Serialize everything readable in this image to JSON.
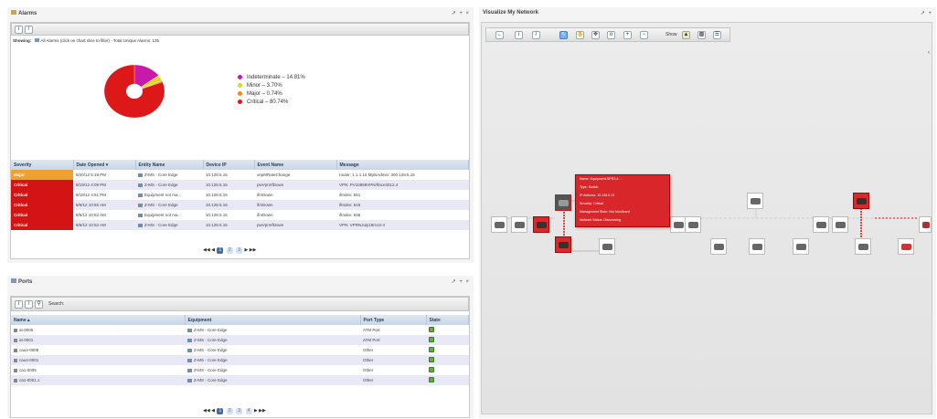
{
  "alarms": {
    "title": "Alarms",
    "controls": "↗ + ×",
    "showing_label": "Showing:",
    "showing_text": "All Alarms (click on chart slice to filter) - Total Unique Alarms: 135",
    "legend": [
      {
        "label": "Indeterminate – 14.81%",
        "color": "#c81aa8"
      },
      {
        "label": "Minor – 3.70%",
        "color": "#e0d820"
      },
      {
        "label": "Major – 0.74%",
        "color": "#f08a20"
      },
      {
        "label": "Critical – 80.74%",
        "color": "#dd1818"
      }
    ],
    "columns": [
      "Severity",
      "Date Opened ▾",
      "Entity Name",
      "Device IP",
      "Event Name",
      "Message"
    ],
    "rows": [
      {
        "severity": "Major",
        "date": "8/20/12 5:18 PM",
        "entity": "Z-MS - Core Edge",
        "ip": "10.128.5.15",
        "event": "vepMRateChange",
        "message": "router: 1.1.1.15 MplsAdmin: 300.128.5.15"
      },
      {
        "severity": "Critical",
        "date": "8/19/12 4:09 PM",
        "entity": "Z-MS - Core Edge",
        "ip": "10.128.5.15",
        "event": "pwVprnIfDown",
        "message": "VPN: PV10889VPN/Iface3012.4"
      },
      {
        "severity": "Critical",
        "date": "8/18/12 4:51 PM",
        "entity": "Equipment not ma...",
        "ip": "10.128.5.15",
        "event": "ifmDown",
        "message": "ifIndex: 551"
      },
      {
        "severity": "Critical",
        "date": "8/6/12 10:55 AM",
        "entity": "Z-MS - Core Edge",
        "ip": "10.128.5.15",
        "event": "ifmDown",
        "message": "ifIndex: 615"
      },
      {
        "severity": "Critical",
        "date": "8/6/12 10:52 AM",
        "entity": "Equipment not ma...",
        "ip": "10.128.5.15",
        "event": "ifmDown",
        "message": "ifIndex: 636"
      },
      {
        "severity": "Critical",
        "date": "8/6/12 10:52 AM",
        "entity": "Z-MS - Core Edge",
        "ip": "10.128.5.15",
        "event": "pwVprnIfDown",
        "message": "VPN: VPRNJuly18m12-4"
      }
    ],
    "pager": {
      "first": "◀◀",
      "prev": "◀",
      "pages": [
        "1",
        "2",
        "3"
      ],
      "next": "▶",
      "last": "▶▶"
    },
    "chart_data": {
      "type": "pie",
      "categories": [
        "Indeterminate",
        "Minor",
        "Major",
        "Critical"
      ],
      "values": [
        14.81,
        3.7,
        0.74,
        80.74
      ],
      "colors": [
        "#c81aa8",
        "#e0d820",
        "#f08a20",
        "#dd1818"
      ]
    }
  },
  "ports": {
    "title": "Ports",
    "controls": "↗ + ×",
    "search_label": "Search:",
    "columns": [
      "Name ▴",
      "Equipment",
      "Port Type",
      "State"
    ],
    "rows": [
      {
        "name": "at-0005",
        "equipment": "Z-MS - Core Edge",
        "type": "ATM Port"
      },
      {
        "name": "at-0001",
        "equipment": "Z-MS - Core Edge",
        "type": "ATM Port"
      },
      {
        "name": "cau4-0005",
        "equipment": "Z-MS - Core Edge",
        "type": "Other"
      },
      {
        "name": "cau4-0001",
        "equipment": "Z-MS - Core Edge",
        "type": "Other"
      },
      {
        "name": "ca1-0005",
        "equipment": "Z-MS - Core Edge",
        "type": "Other"
      },
      {
        "name": "ca1-0001.1",
        "equipment": "Z-MS - Core Edge",
        "type": "Other"
      }
    ],
    "pager": {
      "first": "◀◀",
      "prev": "◀",
      "pages": [
        "1",
        "2",
        "3",
        "4"
      ],
      "next": "▶",
      "last": "▶▶"
    }
  },
  "network": {
    "title": "Visualize My Network",
    "controls": "↗ +",
    "show_label": "Show",
    "tooltip": [
      "Name: Equipment-SPR3-4 ...",
      "Type: Switch",
      "IP Address: 10.128.5.15",
      "Severity: Critical",
      "Management State: Not Monitored",
      "Network Status: Discovering"
    ]
  }
}
